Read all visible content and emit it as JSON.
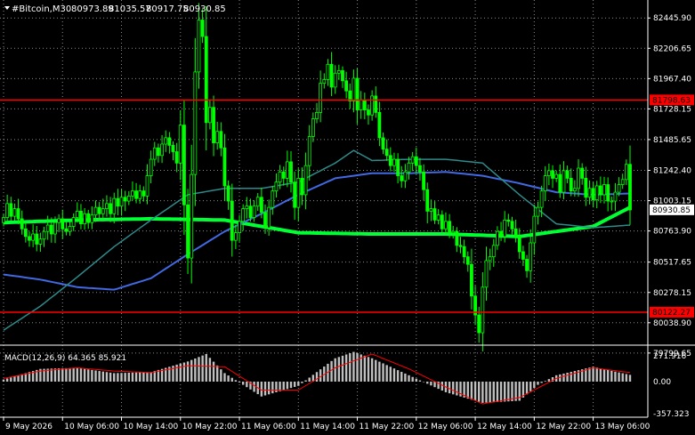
{
  "header": {
    "symbol": "#Bitcoin,M30",
    "open": "80973.89",
    "high": "81035.57",
    "low": "80917.75",
    "close": "80930.85",
    "menu_icon": "triangle-down-icon"
  },
  "colors": {
    "background": "#000000",
    "grid": "#ffffff",
    "candle": "#00ff00",
    "ma_fast": "#00ff33",
    "ma_blue": "#4169e1",
    "ma_teal": "#2e8b8b",
    "hline": "#ff0000",
    "macd_hist": "#c0c0c0",
    "macd_signal": "#ff0000",
    "axis_text": "#ffffff"
  },
  "chart_data": [
    {
      "type": "line",
      "title": "#Bitcoin,M30",
      "ylim": [
        79890,
        82560
      ],
      "y_ticks": [
        "82445.90",
        "82206.65",
        "81967.40",
        "81728.15",
        "81485.65",
        "81242.40",
        "81003.15",
        "80763.90",
        "80517.65",
        "80278.15",
        "80038.90",
        "79799.65"
      ],
      "x_labels": [
        "9 May 2026",
        "10 May 06:00",
        "10 May 14:00",
        "10 May 22:00",
        "11 May 06:00",
        "11 May 14:00",
        "11 May 22:00",
        "12 May 06:00",
        "12 May 14:00",
        "12 May 22:00",
        "13 May 06:00"
      ],
      "x_label_bars": [
        0,
        16,
        32,
        48,
        64,
        80,
        96,
        112,
        128,
        144,
        160
      ],
      "bars_count": 171,
      "price_closes": [
        80870,
        80980,
        80880,
        80940,
        80860,
        80780,
        80720,
        80690,
        80740,
        80660,
        80700,
        80760,
        80810,
        80740,
        80830,
        80860,
        80780,
        80760,
        80800,
        80870,
        80920,
        80820,
        80900,
        80830,
        80890,
        80950,
        80900,
        80940,
        80980,
        80900,
        81020,
        80960,
        81030,
        81000,
        81040,
        81080,
        81020,
        81080,
        81040,
        81200,
        81330,
        81420,
        81360,
        81450,
        81500,
        81440,
        81390,
        81300,
        81600,
        80970,
        80550,
        81210,
        82020,
        82430,
        82300,
        81620,
        81740,
        81460,
        81550,
        81420,
        81120,
        81000,
        80690,
        80750,
        80840,
        80940,
        80960,
        80870,
        80960,
        81030,
        80910,
        80790,
        80950,
        81080,
        81150,
        81230,
        81180,
        81310,
        81150,
        80950,
        81180,
        81050,
        81280,
        81510,
        81650,
        81700,
        81930,
        81960,
        82080,
        81900,
        82010,
        82030,
        81950,
        81870,
        81790,
        81970,
        81720,
        81800,
        81720,
        81680,
        81830,
        81700,
        81500,
        81410,
        81360,
        81280,
        81330,
        81200,
        81160,
        81230,
        81300,
        81350,
        81280,
        81230,
        81090,
        80920,
        80940,
        80850,
        80890,
        80780,
        80840,
        80750,
        80760,
        80650,
        80640,
        80560,
        80500,
        80250,
        80100,
        79960,
        80320,
        80530,
        80560,
        80650,
        80760,
        80720,
        80850,
        80840,
        80780,
        80720,
        80600,
        80540,
        80450,
        80670,
        80880,
        80950,
        81080,
        81200,
        81240,
        81180,
        81210,
        81070,
        81240,
        81180,
        81080,
        81100,
        81260,
        81180,
        81030,
        81100,
        81010,
        81120,
        81050,
        81130,
        81000,
        81000,
        81070,
        81130,
        81170,
        81290,
        80930
      ],
      "levels": [
        81798.63,
        80122.27
      ],
      "level_labels": [
        "81798.63",
        "80122.27"
      ],
      "current_price": "80930.85",
      "moving_averages": [
        {
          "color": "#00ff33",
          "x": [
            0,
            20,
            40,
            60,
            80,
            100,
            120,
            140,
            160,
            170
          ],
          "y": [
            80830,
            80850,
            80860,
            80850,
            80750,
            80740,
            80740,
            80720,
            80800,
            80950
          ]
        },
        {
          "color": "#4169e1",
          "x": [
            0,
            10,
            20,
            30,
            40,
            50,
            60,
            70,
            80,
            90,
            100,
            110,
            120,
            130,
            140,
            150,
            160,
            170
          ],
          "y": [
            80420,
            80380,
            80320,
            80300,
            80390,
            80580,
            80760,
            80900,
            81050,
            81180,
            81220,
            81220,
            81230,
            81200,
            81140,
            81070,
            81050,
            81060
          ]
        },
        {
          "color": "#2e8b8b",
          "x": [
            0,
            10,
            20,
            30,
            40,
            50,
            60,
            70,
            80,
            90,
            95,
            100,
            110,
            120,
            130,
            140,
            150,
            160,
            170
          ],
          "y": [
            79980,
            80170,
            80400,
            80640,
            80850,
            81050,
            81100,
            81100,
            81150,
            81300,
            81400,
            81320,
            81330,
            81330,
            81300,
            81050,
            80820,
            80790,
            80810
          ]
        }
      ],
      "grid": true
    },
    {
      "type": "bar",
      "title": "MACD(12,26,9) 64.365 85.921",
      "ylim": [
        -310,
        310
      ],
      "y_ticks": [
        "271.916",
        "0.00",
        "-357.323"
      ],
      "histogram": {
        "x": [
          0,
          10,
          20,
          30,
          40,
          50,
          55,
          60,
          70,
          80,
          90,
          95,
          100,
          110,
          120,
          130,
          140,
          145,
          150,
          160,
          170
        ],
        "y": [
          20,
          120,
          130,
          80,
          90,
          190,
          260,
          80,
          -140,
          -40,
          220,
          280,
          220,
          60,
          -100,
          -200,
          -180,
          -30,
          60,
          140,
          64
        ]
      },
      "signal": {
        "x": [
          0,
          10,
          20,
          30,
          40,
          50,
          60,
          70,
          80,
          90,
          100,
          110,
          120,
          130,
          140,
          150,
          160,
          170
        ],
        "y": [
          30,
          100,
          130,
          100,
          85,
          150,
          140,
          -80,
          -80,
          130,
          260,
          120,
          -50,
          -210,
          -150,
          30,
          130,
          86
        ]
      }
    }
  ]
}
